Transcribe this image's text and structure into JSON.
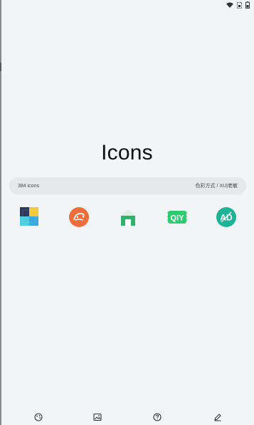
{
  "app": {
    "title": "Icons"
  },
  "statusbar": {
    "icons": [
      "wifi-icon",
      "sim-icon",
      "battery-icon"
    ]
  },
  "info_bar": {
    "count_text": "384 icons",
    "style_label": "色彩方式",
    "separator": "/",
    "author_label": "XU|老敏"
  },
  "icon_grid": {
    "icons": [
      "photo-gallery-icon",
      "alibaba-icon",
      "home-icon",
      "iqiyi-icon",
      "ad-block-icon"
    ]
  },
  "bottom_nav": {
    "items": [
      "palette-icon",
      "wallpaper-icon",
      "help-icon",
      "edit-icon"
    ]
  },
  "colors": {
    "background": "#f3f4f6",
    "bar": "#e7e8ea",
    "alibaba_orange": "#ee6d3a",
    "home_green": "#2db36b",
    "iqiyi_green": "#2ecc71",
    "ad_teal": "#1db397"
  }
}
